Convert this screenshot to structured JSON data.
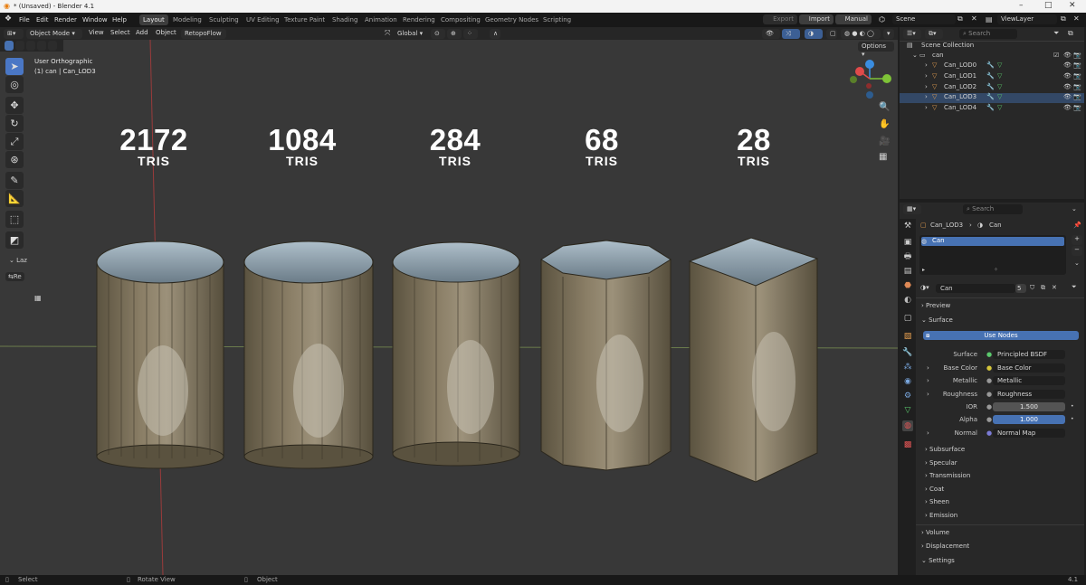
{
  "window": {
    "title": "* (Unsaved) - Blender 4.1"
  },
  "menus": [
    "File",
    "Edit",
    "Render",
    "Window",
    "Help"
  ],
  "workspaces": [
    {
      "label": "Layout",
      "active": true
    },
    {
      "label": "Modeling"
    },
    {
      "label": "Sculpting"
    },
    {
      "label": "UV Editing"
    },
    {
      "label": "Texture Paint"
    },
    {
      "label": "Shading"
    },
    {
      "label": "Animation"
    },
    {
      "label": "Rendering"
    },
    {
      "label": "Compositing"
    },
    {
      "label": "Geometry Nodes"
    },
    {
      "label": "Scripting"
    }
  ],
  "topright": {
    "export": "Export",
    "import": "Import",
    "manual": "Manual",
    "scene": "Scene",
    "view_layer": "ViewLayer"
  },
  "viewport_header": {
    "mode": "Object Mode",
    "view": "View",
    "select": "Select",
    "add": "Add",
    "object": "Object",
    "addon": "RetopoFlow",
    "orientation": "Global",
    "options": "Options"
  },
  "viewport": {
    "view_name": "User Orthographic",
    "object_info": "(1) can | Can_LOD3",
    "lazy_label": "Laz",
    "re_label": "Re"
  },
  "lods": [
    {
      "tris": "2172",
      "label": "TRIS"
    },
    {
      "tris": "1084",
      "label": "TRIS"
    },
    {
      "tris": "284",
      "label": "TRIS"
    },
    {
      "tris": "68",
      "label": "TRIS"
    },
    {
      "tris": "28",
      "label": "TRIS"
    }
  ],
  "outliner": {
    "search_placeholder": "Search",
    "collection": "Scene Collection",
    "root": "can",
    "items": [
      "Can_LOD0",
      "Can_LOD1",
      "Can_LOD2",
      "Can_LOD3",
      "Can_LOD4"
    ]
  },
  "properties": {
    "search_placeholder": "Search",
    "object": "Can_LOD3",
    "material_name": "Can",
    "slot": "Can",
    "user_count": "5",
    "sections": {
      "preview": "Preview",
      "surface": "Surface",
      "use_nodes": "Use Nodes",
      "subsurface": "Subsurface",
      "specular": "Specular",
      "transmission": "Transmission",
      "coat": "Coat",
      "sheen": "Sheen",
      "emission": "Emission",
      "volume": "Volume",
      "displacement": "Displacement",
      "settings": "Settings"
    },
    "surface_rows": [
      {
        "label": "Surface",
        "value": "Principled BSDF"
      },
      {
        "label": "Base Color",
        "value": "Base Color"
      },
      {
        "label": "Metallic",
        "value": "Metallic"
      },
      {
        "label": "Roughness",
        "value": "Roughness"
      },
      {
        "label": "IOR",
        "value": "1.500"
      },
      {
        "label": "Alpha",
        "value": "1.000"
      },
      {
        "label": "Normal",
        "value": "Normal Map"
      }
    ]
  },
  "statusbar": {
    "select": "Select",
    "rotate": "Rotate View",
    "object": "Object",
    "version": "4.1"
  },
  "colors": {
    "accent": "#4772b3",
    "axis_x": "#e04a4a",
    "axis_y": "#7ec337",
    "axis_z": "#3a8de0"
  }
}
